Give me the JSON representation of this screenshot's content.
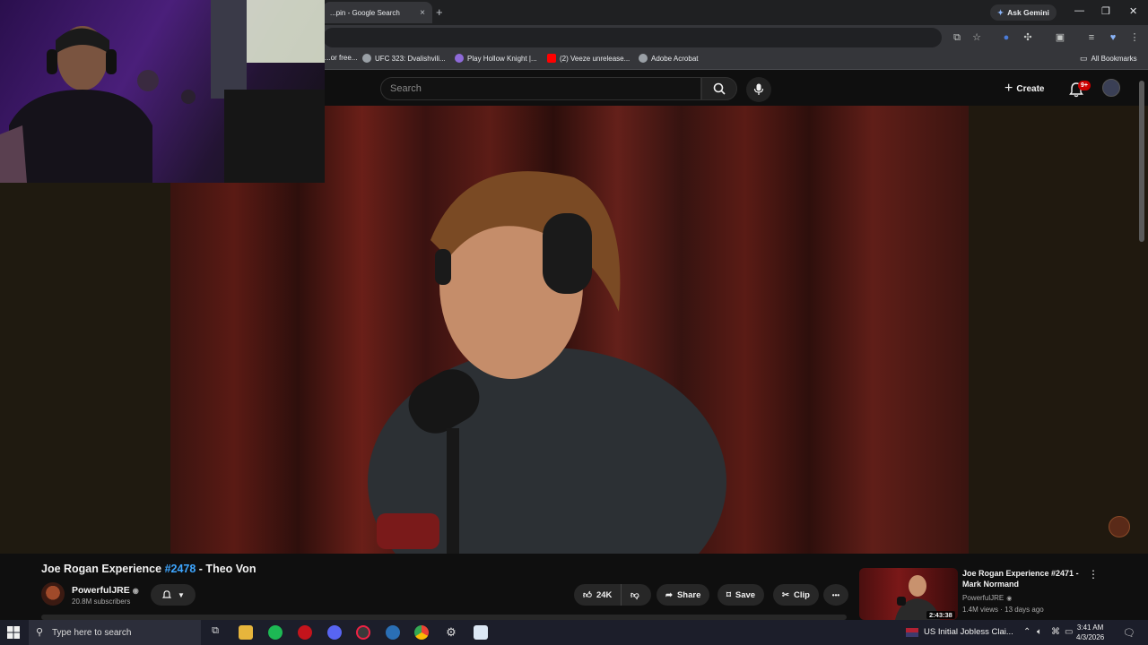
{
  "browser": {
    "tab_active_title": "...pin - Google Search",
    "tab_close": "×",
    "new_tab": "+",
    "ask_gemini": "Ask Gemini",
    "window_controls": [
      "—",
      "❐",
      "✕"
    ]
  },
  "bookmarks": {
    "items": [
      {
        "label": "...or free...",
        "color": "#5f6368"
      },
      {
        "label": "UFC 323: Dvalishvili...",
        "color": "#9aa0a6"
      },
      {
        "label": "Play Hollow Knight |...",
        "color": "#8e6ad8"
      },
      {
        "label": "(2) Veeze unrelease...",
        "color": "#ff0000"
      },
      {
        "label": "Adobe Acrobat",
        "color": "#9aa0a6"
      }
    ],
    "all_bookmarks": "All Bookmarks"
  },
  "youtube": {
    "search_placeholder": "Search",
    "create_label": "Create",
    "notification_count": "9+"
  },
  "video": {
    "title_prefix": "Joe Rogan Experience ",
    "title_tag": "#2478",
    "title_suffix": " - Theo Von",
    "channel_name": "PowerfulJRE",
    "subscribers": "20.8M subscribers",
    "likes": "24K",
    "share_label": "Share",
    "save_label": "Save",
    "clip_label": "Clip",
    "more_label": "•••"
  },
  "recommendation": {
    "title": "Joe Rogan Experience #2471 - Mark Normand",
    "channel": "PowerfulJRE",
    "meta": "1.4M views · 13 days ago",
    "duration": "2:43:38"
  },
  "taskbar": {
    "search_placeholder": "Type here to search",
    "news": "US Initial Jobless Clai...",
    "time": "3:41 AM",
    "date": "4/3/2026"
  }
}
